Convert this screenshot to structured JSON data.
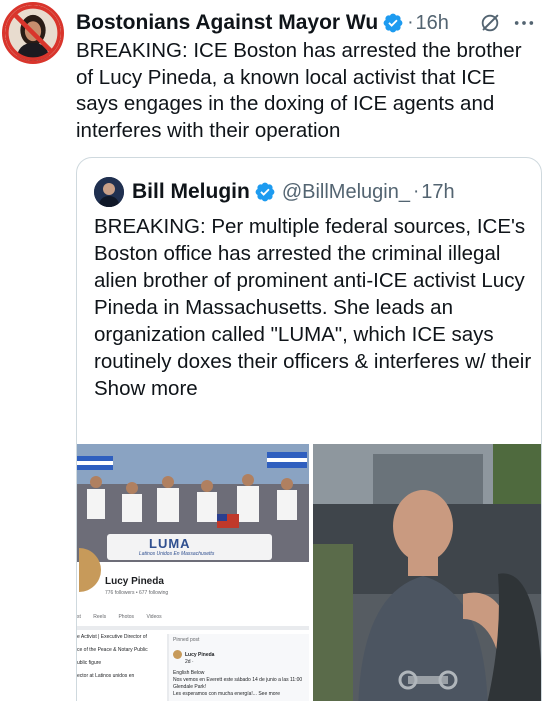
{
  "post": {
    "author": "Bostonians Against Mayor Wu",
    "separator": "·",
    "time": "16h",
    "text": "BREAKING: ICE Boston has arrested the brother of Lucy Pineda, a known local activist that ICE says engages in the doxing of ICE agents and interferes with their operation",
    "icons": {
      "verified": "verified-badge-icon",
      "grok": "grok-icon",
      "more": "more-options-icon"
    }
  },
  "quote": {
    "author": "Bill Melugin",
    "handle": "@BillMelugin_",
    "separator": "·",
    "time": "17h",
    "text": "BREAKING: Per multiple federal sources, ICE's Boston office has arrested the criminal illegal alien brother of prominent anti-ICE activist Lucy Pineda in Massachusetts. She leads an organization called \"LUMA\", which ICE says routinely doxes their officers & interferes w/ their",
    "show_more": "Show more"
  },
  "media": {
    "left": {
      "banner_sign": "LUMA",
      "banner_sub": "Latinos Unidos En Massachusetts",
      "profile_name": "Lucy Pineda",
      "profile_stats": "776 followers • 677 following",
      "tabs": [
        "st",
        "Reels",
        "Photos",
        "Videos"
      ],
      "intro_lines": [
        "e Activist | Executive Director of",
        "ce of the Peace & Notary Public",
        "ublic figure",
        "ector at Latinos unidos en"
      ],
      "pinned_label": "Pinned post",
      "pinned_name": "Lucy Pineda",
      "pinned_meta": "2d · ",
      "pinned_lines": [
        "English Below",
        "Nos vemos en Everett este sábado 14 de junio a las 11:00",
        "Glendale Park!",
        "Les esperamos con mucha energía!... See more"
      ]
    }
  },
  "colors": {
    "text": "#0f1419",
    "secondary": "#536471",
    "verified": "#1d9bf0",
    "border": "#cfd9de",
    "avatar_ring": "#d9352c"
  }
}
